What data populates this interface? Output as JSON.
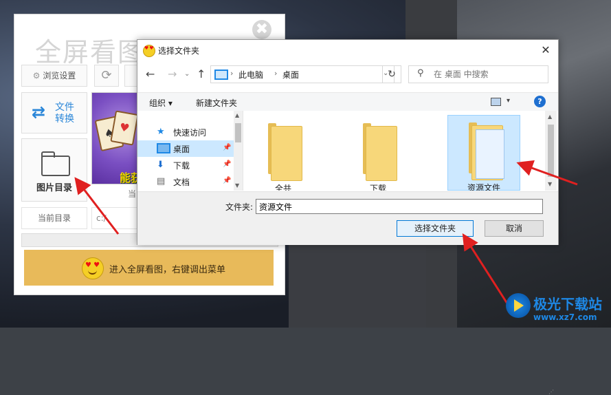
{
  "app": {
    "title": "全屏看图",
    "close_glyph": "✖",
    "browse_settings": "浏览设置",
    "file_convert_line1": "文件",
    "file_convert_line2": "转换",
    "image_directory": "图片目录",
    "preview_text": "能获",
    "current_label_partial": "当",
    "current_directory_label": "当前目录",
    "current_directory_value": "c:/",
    "enter_fullscreen": "进入全屏看图，右键调出菜单"
  },
  "dialog": {
    "title": "选择文件夹",
    "close_glyph": "✕",
    "address": {
      "crumbs": [
        "此电脑",
        "桌面"
      ]
    },
    "search": {
      "placeholder": "在 桌面 中搜索"
    },
    "toolbar": {
      "organize": "组织",
      "new_folder": "新建文件夹",
      "help": "?"
    },
    "nav_pane": {
      "items": [
        {
          "label": "快速访问",
          "icon": "star-icon"
        },
        {
          "label": "桌面",
          "icon": "desktop-icon",
          "selected": true
        },
        {
          "label": "下载",
          "icon": "download-arrow-icon"
        },
        {
          "label": "文档",
          "icon": "document-icon"
        }
      ]
    },
    "files": [
      {
        "label": "全共",
        "icon": "folder-icon"
      },
      {
        "label": "下载",
        "icon": "folder-icon"
      },
      {
        "label": "资源文件",
        "icon": "folder-icon",
        "selected": true
      }
    ],
    "folder_label": "文件夹:",
    "folder_value": "资源文件",
    "select_folder_button": "选择文件夹",
    "cancel_button": "取消"
  },
  "watermark": {
    "name": "极光下载站",
    "url": "www.xz7.com"
  },
  "colors": {
    "accent_blue": "#0078d7",
    "selection": "#cce8ff",
    "fullscreen_bar": "#e8ba5a",
    "annotation_arrow": "#e02020"
  }
}
